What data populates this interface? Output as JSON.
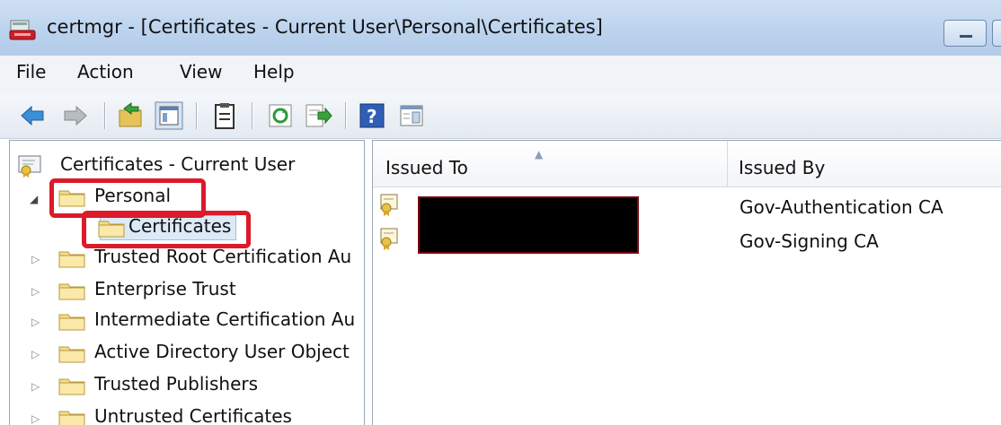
{
  "window": {
    "title": "certmgr - [Certificates - Current User\\Personal\\Certificates]"
  },
  "menu": [
    "File",
    "Action",
    "View",
    "Help"
  ],
  "toolbar": {
    "buttons": [
      "back-arrow-icon",
      "forward-arrow-icon",
      "up-folder-icon",
      "show-hide-console-tree-icon",
      "properties-icon",
      "refresh-icon",
      "export-list-icon",
      "help-icon",
      "action-pane-icon"
    ]
  },
  "tree": {
    "root": "Certificates - Current User",
    "items": [
      {
        "label": "Personal",
        "expanded": true
      },
      {
        "label": "Certificates",
        "selected": true
      },
      {
        "label": "Trusted Root Certification Au"
      },
      {
        "label": "Enterprise Trust"
      },
      {
        "label": "Intermediate Certification Au"
      },
      {
        "label": "Active Directory User Object"
      },
      {
        "label": "Trusted Publishers"
      },
      {
        "label": "Untrusted Certificates"
      }
    ]
  },
  "list": {
    "columns": [
      "Issued To",
      "Issued By"
    ],
    "rows": [
      {
        "issued_to": "",
        "issued_by": "Gov-Authentication CA"
      },
      {
        "issued_to": "",
        "issued_by": "Gov-Signing CA"
      }
    ]
  },
  "colors": {
    "annotation": "#dc1a2a",
    "titlebar": "#bcd3ee"
  }
}
